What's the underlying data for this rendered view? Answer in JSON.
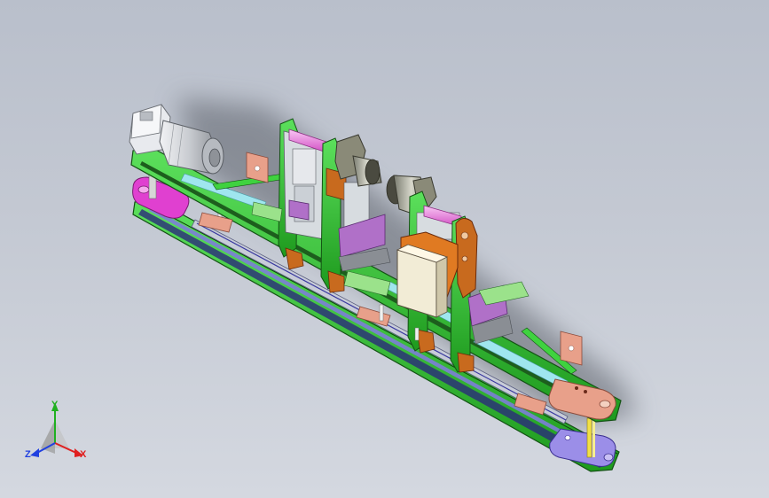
{
  "viewport": {
    "background_top": "#b9bfcb",
    "background_bottom": "#d4d8e0"
  },
  "model": {
    "colors": {
      "frame_green": "#33cc33",
      "frame_dark": "#1f5f1f",
      "motor_gray": "#cfd2d6",
      "pink_shaft": "#f08ee8",
      "magenta_plate": "#e040d0",
      "purple_block": "#b070c8",
      "orange_bracket": "#c86a1e",
      "salmon_plate": "#e8a08a",
      "cyan_strip": "#9fe6ee",
      "lavender_plate": "#9b8ee8",
      "rail_blue": "#3a3aa0",
      "cream_box": "#f2ecd6"
    }
  },
  "triad": {
    "x_label": "X",
    "y_label": "Y",
    "z_label": "Z",
    "x_color": "#e02020",
    "y_color": "#20b020",
    "z_color": "#2040e0"
  }
}
